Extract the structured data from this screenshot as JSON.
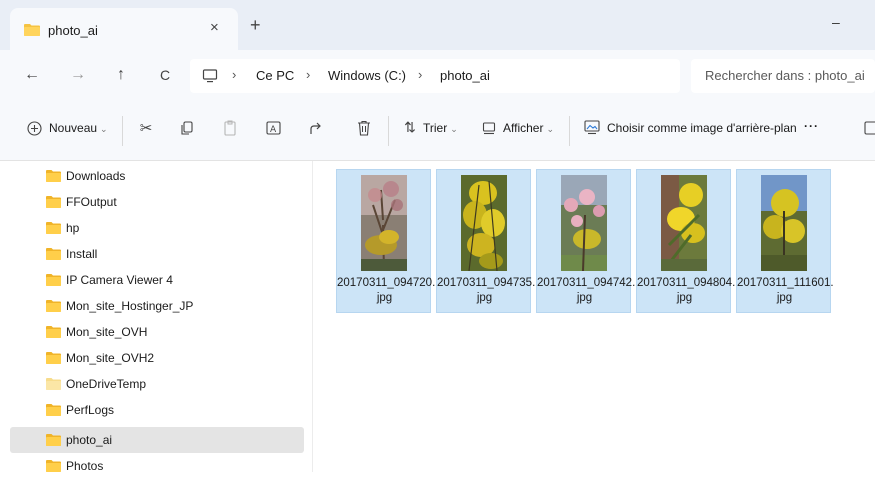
{
  "window": {
    "tab_title": "photo_ai",
    "tab_close": "×",
    "new_tab": "+",
    "minimize": "–"
  },
  "nav": {
    "back": "←",
    "forward": "→",
    "up": "↑",
    "refresh": "C"
  },
  "address": {
    "crumbs": [
      "Ce PC",
      "Windows (C:)",
      "photo_ai"
    ],
    "separator": "›"
  },
  "search": {
    "placeholder": "Rechercher dans : photo_ai"
  },
  "toolbar": {
    "new_label": "Nouveau",
    "sort_label": "Trier",
    "view_label": "Afficher",
    "background_label": "Choisir comme image d'arrière-plan",
    "more_label": "···"
  },
  "sidebar": {
    "items": [
      {
        "label": "Downloads",
        "selected": false
      },
      {
        "label": "FFOutput",
        "selected": false
      },
      {
        "label": "hp",
        "selected": false
      },
      {
        "label": "Install",
        "selected": false
      },
      {
        "label": "IP Camera Viewer 4",
        "selected": false
      },
      {
        "label": "Mon_site_Hostinger_JP",
        "selected": false
      },
      {
        "label": "Mon_site_OVH",
        "selected": false
      },
      {
        "label": "Mon_site_OVH2",
        "selected": false
      },
      {
        "label": "OneDriveTemp",
        "selected": false
      },
      {
        "label": "PerfLogs",
        "selected": false
      },
      {
        "label": "photo_ai",
        "selected": true
      },
      {
        "label": "Photos",
        "selected": false
      }
    ]
  },
  "files": [
    {
      "name_line1": "20170311_094720.",
      "name_line2": "jpg"
    },
    {
      "name_line1": "20170311_094735.",
      "name_line2": "jpg"
    },
    {
      "name_line1": "20170311_094742.",
      "name_line2": "jpg"
    },
    {
      "name_line1": "20170311_094804.",
      "name_line2": "jpg"
    },
    {
      "name_line1": "20170311_111601.",
      "name_line2": "jpg"
    }
  ],
  "colors": {
    "accent_selection": "#cce4f7",
    "folder": "#f5c342",
    "titlebar": "#e9eef6"
  }
}
